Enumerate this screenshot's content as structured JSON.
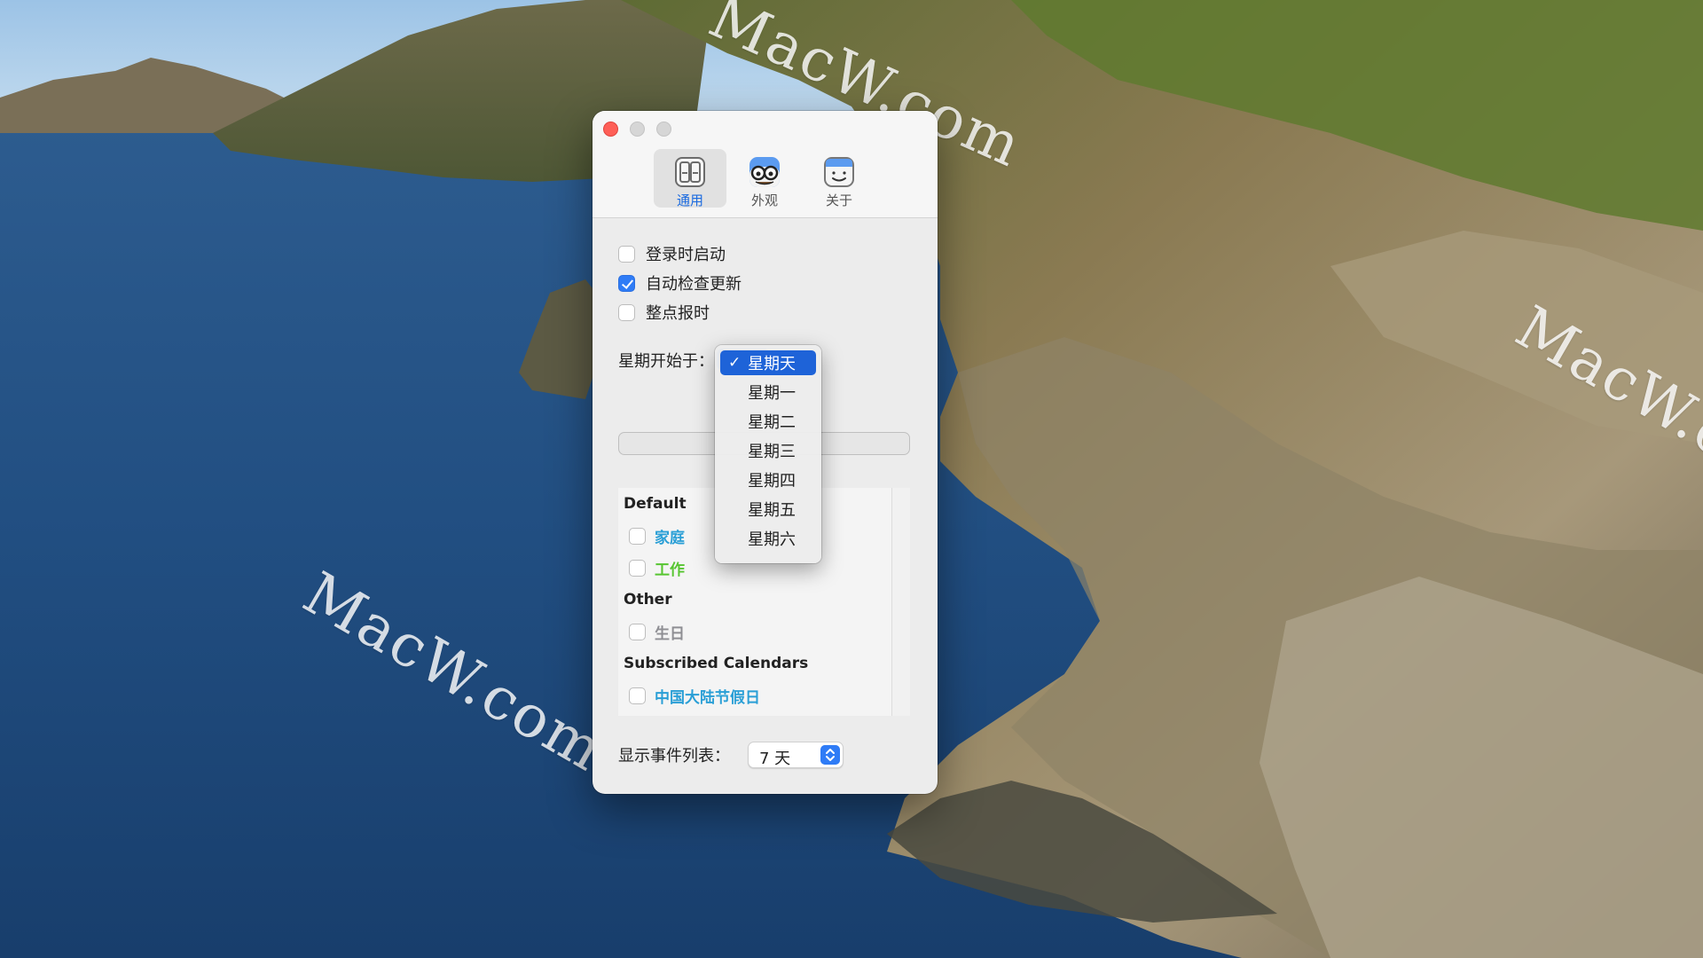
{
  "watermark": "MacW.com",
  "window": {
    "toolbar": [
      {
        "label": "通用",
        "icon": "general-icon",
        "active": true
      },
      {
        "label": "外观",
        "icon": "appearance-icon",
        "active": false
      },
      {
        "label": "关于",
        "icon": "about-icon",
        "active": false
      }
    ],
    "options": [
      {
        "label": "登录时启动",
        "checked": false
      },
      {
        "label": "自动检查更新",
        "checked": true
      },
      {
        "label": "整点报时",
        "checked": false
      }
    ],
    "week_start": {
      "label": "星期开始于：",
      "selected": "星期天",
      "options": [
        "星期天",
        "星期一",
        "星期二",
        "星期三",
        "星期四",
        "星期五",
        "星期六"
      ]
    },
    "calendars": {
      "groups": [
        {
          "header": "Default",
          "items": [
            {
              "label": "家庭",
              "color": "#2a9fd6",
              "checked": false
            },
            {
              "label": "工作",
              "color": "#57c531",
              "checked": false
            }
          ]
        },
        {
          "header": "Other",
          "items": [
            {
              "label": "生日",
              "color": "#8e8e93",
              "checked": false
            }
          ]
        },
        {
          "header": "Subscribed Calendars",
          "items": [
            {
              "label": "中国大陆节假日",
              "color": "#2a9fd6",
              "checked": false
            }
          ]
        }
      ]
    },
    "event_list": {
      "label": "显示事件列表：",
      "value": "7 天"
    }
  },
  "colors": {
    "accent": "#2f7cf6",
    "menu_selection": "#1e63d8",
    "close_button": "#fe5f57"
  }
}
